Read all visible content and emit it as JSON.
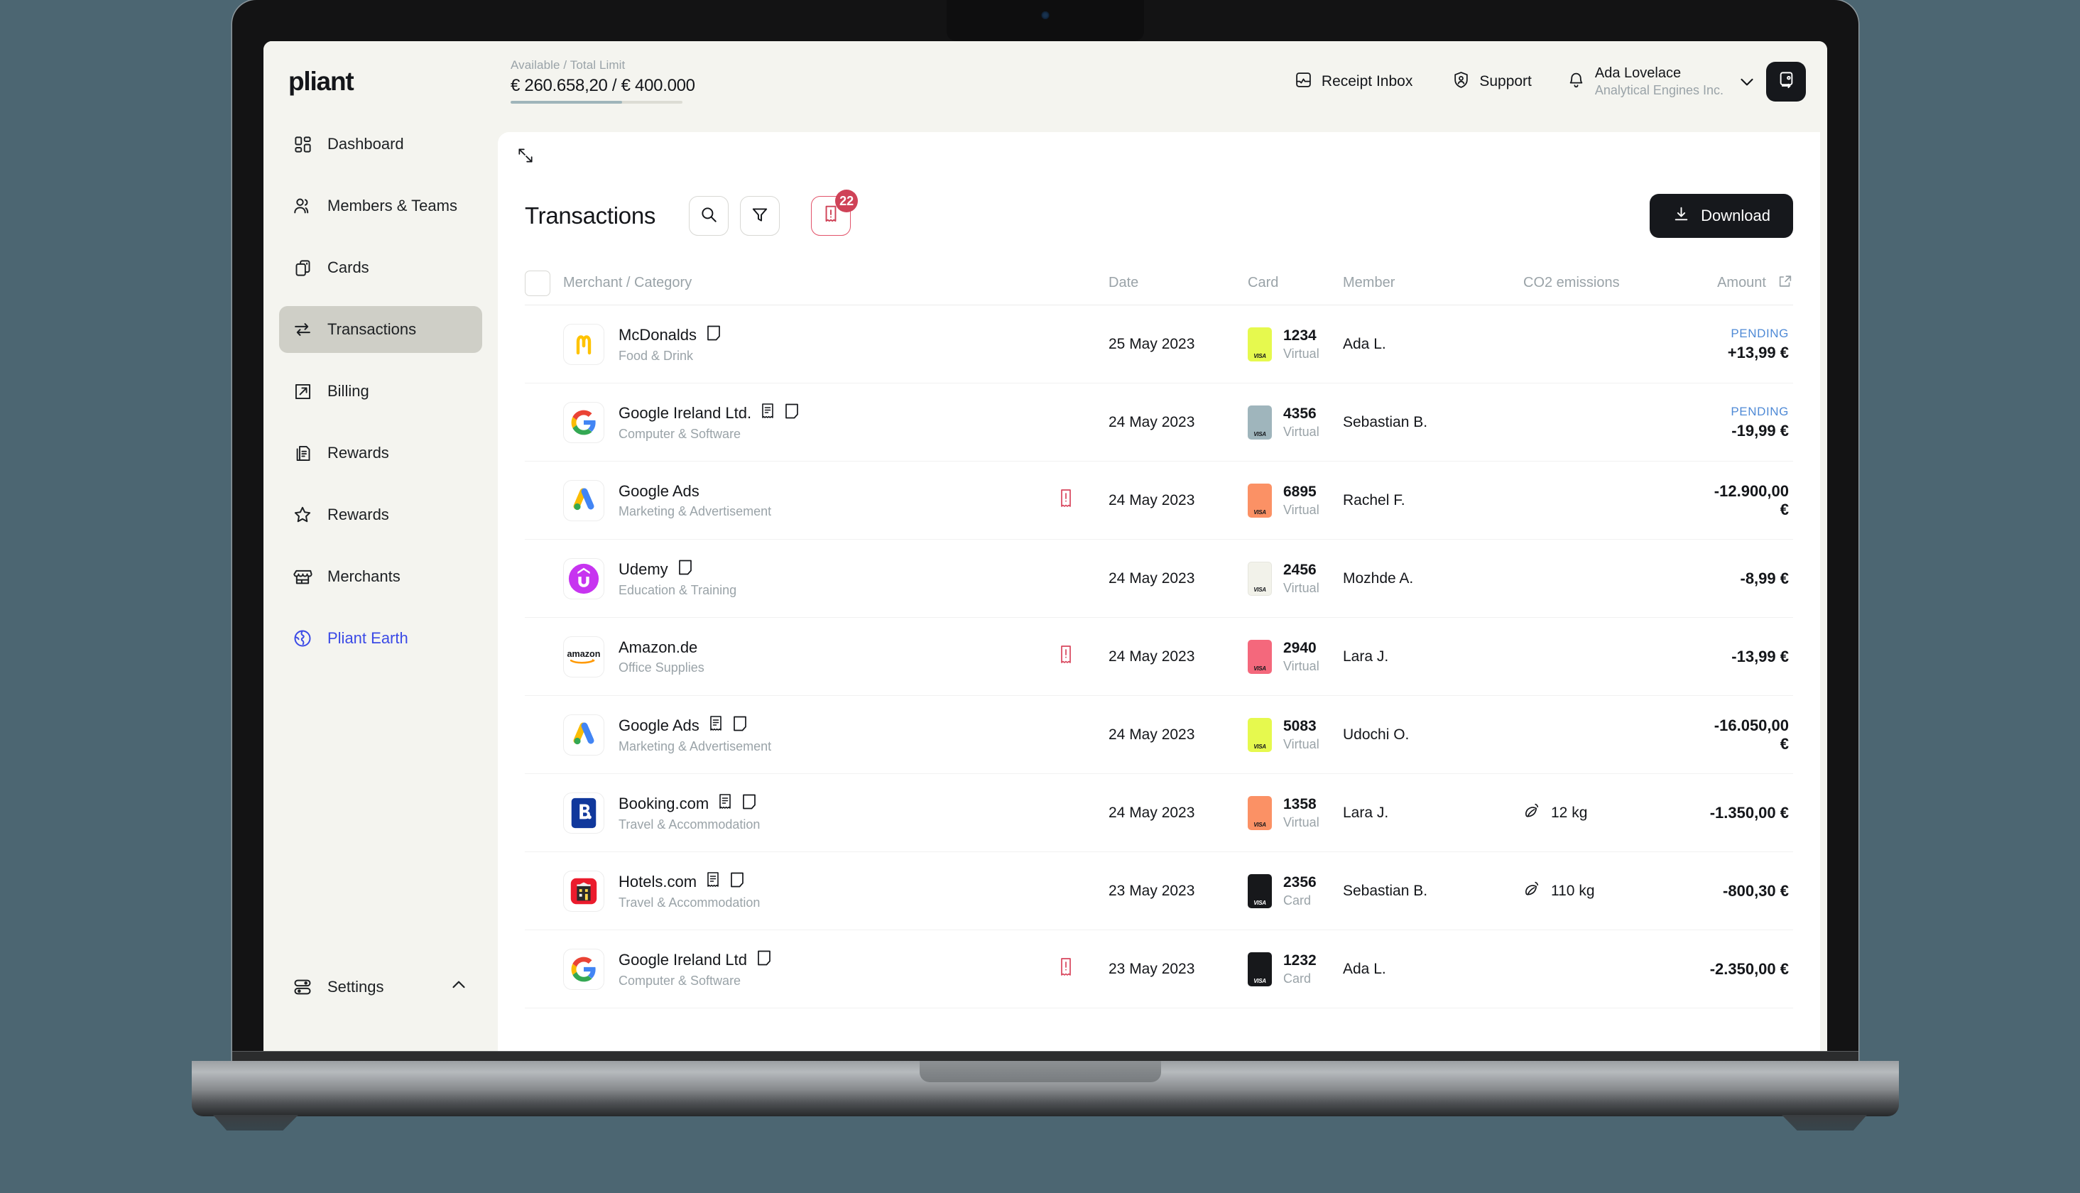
{
  "topbar": {
    "brand": "pliant",
    "limit_label": "Available / Total Limit",
    "limit_value": "€ 260.658,20 / € 400.000",
    "receipt_inbox_label": "Receipt Inbox",
    "support_label": "Support",
    "user_name": "Ada Lovelace",
    "user_org": "Analytical Engines Inc."
  },
  "sidebar": {
    "items": [
      {
        "label": "Dashboard",
        "icon": "dashboard-icon",
        "active": false,
        "accent": false
      },
      {
        "label": "Members & Teams",
        "icon": "members-icon",
        "active": false,
        "accent": false
      },
      {
        "label": "Cards",
        "icon": "cards-icon",
        "active": false,
        "accent": false
      },
      {
        "label": "Transactions",
        "icon": "transactions-icon",
        "active": true,
        "accent": false
      },
      {
        "label": "Billing",
        "icon": "billing-icon",
        "active": false,
        "accent": false
      },
      {
        "label": "Rewards",
        "icon": "documents-icon",
        "active": false,
        "accent": false
      },
      {
        "label": "Rewards",
        "icon": "star-icon",
        "active": false,
        "accent": false
      },
      {
        "label": "Merchants",
        "icon": "storefront-icon",
        "active": false,
        "accent": false
      },
      {
        "label": "Pliant Earth",
        "icon": "globe-icon",
        "active": false,
        "accent": true
      }
    ],
    "settings_label": "Settings",
    "accent_color": "#3b4ae6"
  },
  "page": {
    "title": "Transactions",
    "download_label": "Download",
    "receipt_alert_count": "22"
  },
  "table": {
    "columns": {
      "merchant": "Merchant / Category",
      "date": "Date",
      "card": "Card",
      "member": "Member",
      "co2": "CO2 emissions",
      "amount": "Amount"
    },
    "rows": [
      {
        "merchant": "McDonalds",
        "category": "Food & Drink",
        "logo": "mcdonalds-logo",
        "has_note": true,
        "has_receipt": false,
        "missing_receipt": false,
        "date": "25 May 2023",
        "card_number": "1234",
        "card_type": "Virtual",
        "card_color": "#e6f94e",
        "member": "Ada L.",
        "co2": "",
        "status": "PENDING",
        "amount": "+13,99 €"
      },
      {
        "merchant": "Google Ireland Ltd.",
        "category": "Computer & Software",
        "logo": "google-logo",
        "has_note": true,
        "has_receipt": true,
        "missing_receipt": false,
        "date": "24 May 2023",
        "card_number": "4356",
        "card_type": "Virtual",
        "card_color": "#9fb5bc",
        "member": "Sebastian B.",
        "co2": "",
        "status": "PENDING",
        "amount": "-19,99 €"
      },
      {
        "merchant": "Google Ads",
        "category": "Marketing & Advertisement",
        "logo": "google-ads-logo",
        "has_note": false,
        "has_receipt": false,
        "missing_receipt": true,
        "date": "24 May 2023",
        "card_number": "6895",
        "card_type": "Virtual",
        "card_color": "#fb9165",
        "member": "Rachel F.",
        "co2": "",
        "status": "",
        "amount": "-12.900,00 €"
      },
      {
        "merchant": "Udemy",
        "category": "Education & Training",
        "logo": "udemy-logo",
        "has_note": true,
        "has_receipt": false,
        "missing_receipt": false,
        "date": "24 May 2023",
        "card_number": "2456",
        "card_type": "Virtual",
        "card_color": "#f2f2ea",
        "member": "Mozhde A.",
        "co2": "",
        "status": "",
        "amount": "-8,99 €"
      },
      {
        "merchant": "Amazon.de",
        "category": "Office Supplies",
        "logo": "amazon-logo",
        "has_note": false,
        "has_receipt": false,
        "missing_receipt": true,
        "date": "24 May 2023",
        "card_number": "2940",
        "card_type": "Virtual",
        "card_color": "#f4687c",
        "member": "Lara J.",
        "co2": "",
        "status": "",
        "amount": "-13,99 €"
      },
      {
        "merchant": "Google Ads",
        "category": "Marketing & Advertisement",
        "logo": "google-ads-logo",
        "has_note": true,
        "has_receipt": true,
        "missing_receipt": false,
        "date": "24 May 2023",
        "card_number": "5083",
        "card_type": "Virtual",
        "card_color": "#e6f94e",
        "member": "Udochi O.",
        "co2": "",
        "status": "",
        "amount": "-16.050,00 €"
      },
      {
        "merchant": "Booking.com",
        "category": "Travel & Accommodation",
        "logo": "booking-logo",
        "has_note": true,
        "has_receipt": true,
        "missing_receipt": false,
        "date": "24 May 2023",
        "card_number": "1358",
        "card_type": "Virtual",
        "card_color": "#fb9165",
        "member": "Lara J.",
        "co2": "12 kg",
        "status": "",
        "amount": "-1.350,00 €"
      },
      {
        "merchant": "Hotels.com",
        "category": "Travel & Accommodation",
        "logo": "hotels-logo",
        "has_note": true,
        "has_receipt": true,
        "missing_receipt": false,
        "date": "23 May 2023",
        "card_number": "2356",
        "card_type": "Card",
        "card_color": "#17181b",
        "member": "Sebastian B.",
        "co2": "110 kg",
        "status": "",
        "amount": "-800,30 €"
      },
      {
        "merchant": "Google Ireland Ltd",
        "category": "Computer & Software",
        "logo": "google-logo",
        "has_note": true,
        "has_receipt": false,
        "missing_receipt": true,
        "date": "23 May 2023",
        "card_number": "1232",
        "card_type": "Card",
        "card_color": "#17181b",
        "member": "Ada L.",
        "co2": "",
        "status": "",
        "amount": "-2.350,00 €"
      }
    ]
  }
}
